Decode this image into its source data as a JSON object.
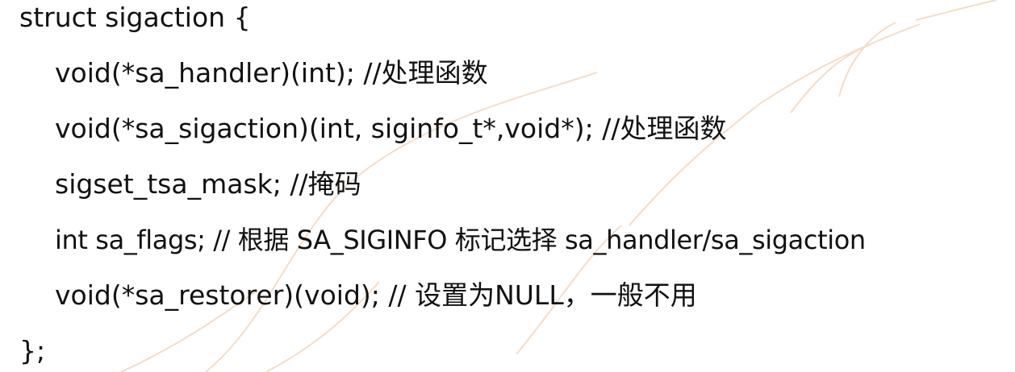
{
  "code": {
    "lines": [
      "struct sigaction {",
      "void(*sa_handler)(int); //处理函数",
      "void(*sa_sigaction)(int, siginfo_t*,void*); //处理函数",
      "sigset_tsa_mask; //掩码",
      "int sa_flags; // 根据 SA_SIGINFO 标记选择 sa_handler/sa_sigaction",
      "void(*sa_restorer)(void); // 设置为NULL，一般不用",
      "};"
    ]
  },
  "watermark": {
    "color": "#f4dcc8"
  }
}
